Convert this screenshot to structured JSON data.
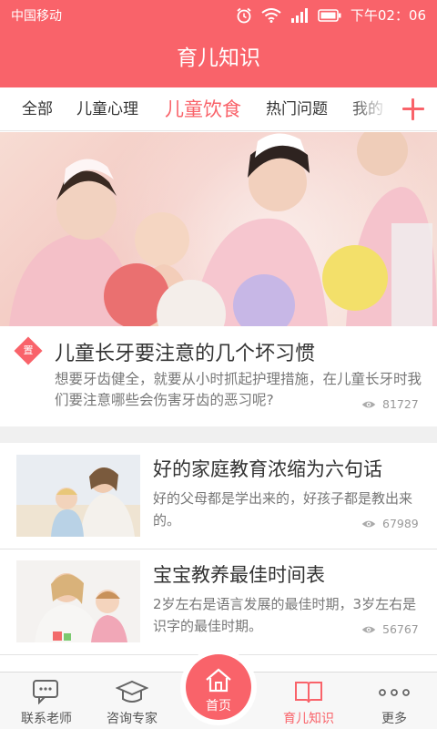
{
  "status_bar": {
    "carrier": "中国移动",
    "time": "下午02：06"
  },
  "header": {
    "title": "育儿知识"
  },
  "tabs": [
    {
      "label": "全部",
      "active": false
    },
    {
      "label": "儿童心理",
      "active": false
    },
    {
      "label": "儿童饮食",
      "active": true
    },
    {
      "label": "热门问题",
      "active": false
    },
    {
      "label": "我的",
      "active": false
    }
  ],
  "featured": {
    "badge": "置",
    "title": "儿童长牙要注意的几个坏习惯",
    "desc": "想要牙齿健全，就要从小时抓起护理措施，在儿童长牙时我们要注意哪些会伤害牙齿的恶习呢?",
    "views": "81727"
  },
  "articles": [
    {
      "title": "好的家庭教育浓缩为六句话",
      "desc": "好的父母都是学出来的，好孩子都是教出来的。",
      "views": "67989"
    },
    {
      "title": "宝宝教养最佳时间表",
      "desc": "2岁左右是语言发展的最佳时期，3岁左右是识字的最佳时期。",
      "views": "56767"
    }
  ],
  "bottom_nav": {
    "items": [
      {
        "label": "联系老师",
        "icon": "chat-icon"
      },
      {
        "label": "咨询专家",
        "icon": "graduation-cap-icon"
      },
      {
        "label": "首页",
        "icon": "home-icon"
      },
      {
        "label": "育儿知识",
        "icon": "book-icon",
        "active": true
      },
      {
        "label": "更多",
        "icon": "more-icon"
      }
    ]
  },
  "colors": {
    "accent": "#f9636a",
    "text": "#333333",
    "muted": "#777777"
  }
}
